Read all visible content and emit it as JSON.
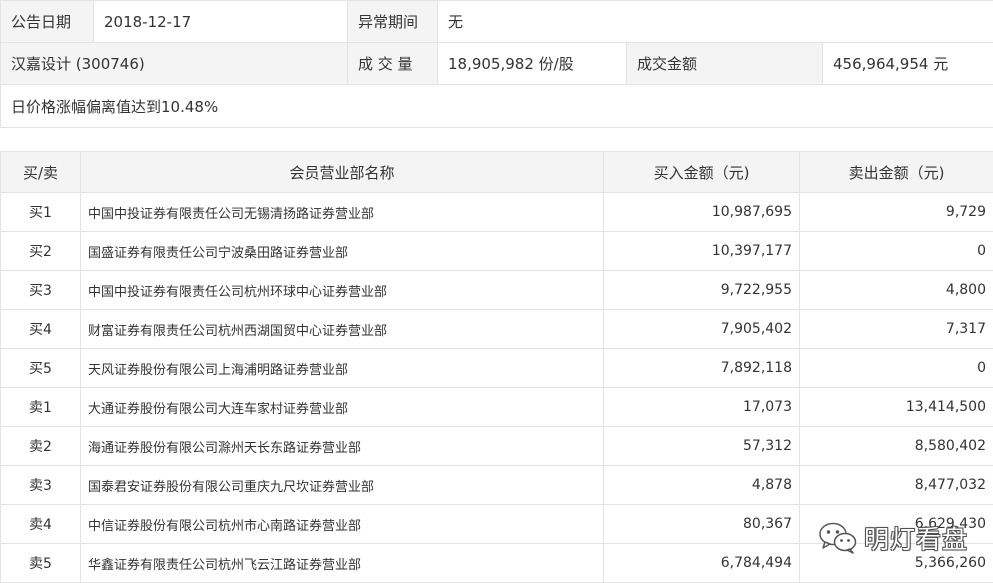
{
  "info": {
    "announce_date_label": "公告日期",
    "announce_date": "2018-12-17",
    "abnormal_period_label": "异常期间",
    "abnormal_period": "无",
    "stock": "汉嘉设计 (300746)",
    "volume_label": "成 交 量",
    "volume": "18,905,982 份/股",
    "amount_label": "成交金额",
    "amount": "456,964,954 元",
    "reason": "日价格涨幅偏离值达到10.48%"
  },
  "table": {
    "headers": [
      "买/卖",
      "会员营业部名称",
      "买入金额（元)",
      "卖出金额（元)"
    ],
    "rows": [
      {
        "side": "买1",
        "name": "中国中投证券有限责任公司无锡清扬路证券营业部",
        "buy": "10,987,695",
        "sell": "9,729"
      },
      {
        "side": "买2",
        "name": "国盛证券有限责任公司宁波桑田路证券营业部",
        "buy": "10,397,177",
        "sell": "0"
      },
      {
        "side": "买3",
        "name": "中国中投证券有限责任公司杭州环球中心证券营业部",
        "buy": "9,722,955",
        "sell": "4,800"
      },
      {
        "side": "买4",
        "name": "财富证券有限责任公司杭州西湖国贸中心证券营业部",
        "buy": "7,905,402",
        "sell": "7,317"
      },
      {
        "side": "买5",
        "name": "天风证券股份有限公司上海浦明路证券营业部",
        "buy": "7,892,118",
        "sell": "0"
      },
      {
        "side": "卖1",
        "name": "大通证券股份有限公司大连车家村证券营业部",
        "buy": "17,073",
        "sell": "13,414,500"
      },
      {
        "side": "卖2",
        "name": "海通证券股份有限公司滁州天长东路证券营业部",
        "buy": "57,312",
        "sell": "8,580,402"
      },
      {
        "side": "卖3",
        "name": "国泰君安证券股份有限公司重庆九尺坎证券营业部",
        "buy": "4,878",
        "sell": "8,477,032"
      },
      {
        "side": "卖4",
        "name": "中信证券股份有限公司杭州市心南路证券营业部",
        "buy": "80,367",
        "sell": "6,629,430"
      },
      {
        "side": "卖5",
        "name": "华鑫证券有限责任公司杭州飞云江路证券营业部",
        "buy": "6,784,494",
        "sell": "5,366,260"
      }
    ]
  },
  "watermark": {
    "text": "明灯看盘",
    "icon": "wechat-icon"
  }
}
